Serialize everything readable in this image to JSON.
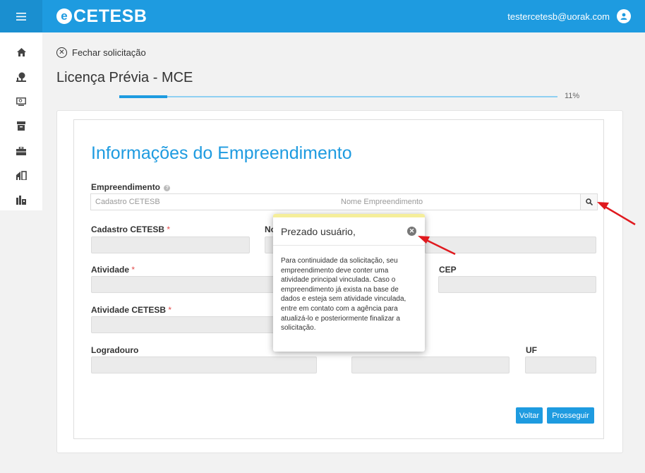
{
  "header": {
    "logo_text": "CETESB",
    "logo_mark": "e",
    "user_email": "testercetesb@uorak.com",
    "menu_icon": "hamburger-icon",
    "user_icon": "user-circle-icon",
    "brand_color": "#1e9be0"
  },
  "sidebar": {
    "items": [
      {
        "icon": "home-icon"
      },
      {
        "icon": "tree-icon"
      },
      {
        "icon": "monitor-icon"
      },
      {
        "icon": "archive-icon"
      },
      {
        "icon": "briefcase-icon"
      },
      {
        "icon": "house-icon"
      },
      {
        "icon": "factory-icon"
      }
    ]
  },
  "page": {
    "close_label": "Fechar solicitação",
    "title": "Licença Prévia - MCE",
    "progress_label": "11%",
    "progress": 0.11
  },
  "form": {
    "section_title": "Informações do Empreendimento",
    "empreendimento_label": "Empreendimento",
    "cadastro_placeholder": "Cadastro CETESB",
    "nome_placeholder": "Nome Empreendimento",
    "fields": {
      "cadastro_cetesb": "Cadastro CETESB",
      "nome_partial": "No",
      "atividade": "Atividade",
      "cep": "CEP",
      "atividade_cetesb": "Atividade CETESB",
      "logradouro": "Logradouro",
      "uf": "UF",
      "required_mark": "*"
    },
    "buttons": {
      "back": "Voltar",
      "next": "Prosseguir"
    }
  },
  "popover": {
    "title": "Prezado usuário,",
    "message": "Para continuidade da solicitação, seu empreendimento deve conter uma atividade principal vinculada. Caso o empreendimento já exista na base de dados e esteja sem atividade vinculada, entre em contato com a agência para atualizá-lo e posteriormente finalizar a solicitação."
  },
  "annotation_color": "#e0191e"
}
